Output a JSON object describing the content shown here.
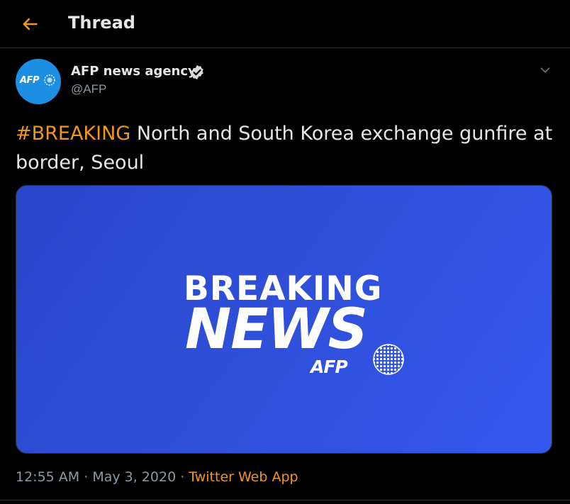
{
  "header": {
    "title": "Thread",
    "back_icon": "arrow-left-icon"
  },
  "tweet": {
    "author": {
      "display_name": "AFP news agency",
      "handle": "@AFP",
      "avatar_label": "AFP",
      "verified": true
    },
    "text": {
      "hashtag": "#BREAKING",
      "body": " North and South Korea exchange gunfire at border, Seoul"
    },
    "media": {
      "line1": "BREAKING",
      "line2": "NEWS",
      "logo": "AFP"
    },
    "time": "12:55 AM",
    "separator1": " · ",
    "date": "May 3, 2020",
    "separator2": " · ",
    "source": "Twitter Web App"
  },
  "colors": {
    "background": "#000000",
    "accent": "#f0971f",
    "muted": "#8b98a5",
    "media_bg": "#3050dd",
    "avatar_bg": "#1d8fe3"
  }
}
